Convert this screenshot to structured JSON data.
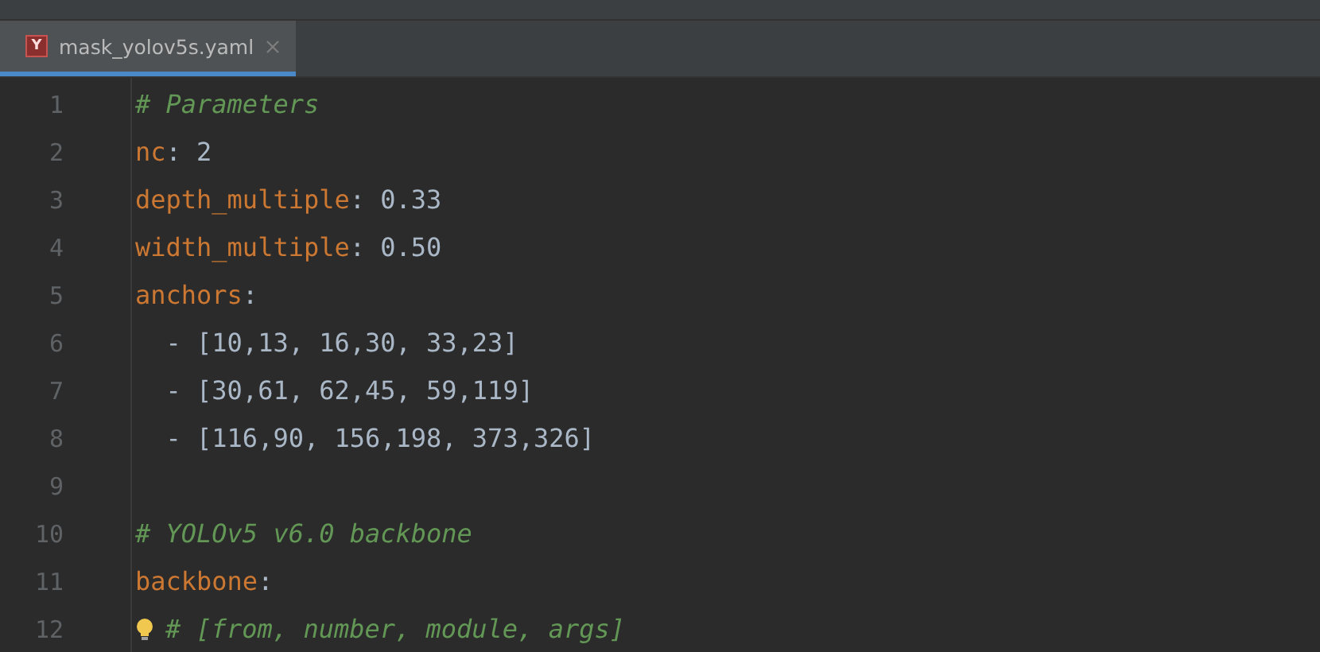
{
  "tabs": [
    {
      "label": "mask_yolov5s.yaml",
      "file_badge": "Y",
      "selected": true
    }
  ],
  "lines": [
    {
      "number": "1",
      "bulb": false,
      "tokens": [
        {
          "kind": "comment",
          "text": "# Parameters"
        }
      ]
    },
    {
      "number": "2",
      "bulb": false,
      "tokens": [
        {
          "kind": "key",
          "text": "nc"
        },
        {
          "kind": "value",
          "text": ": 2"
        }
      ]
    },
    {
      "number": "3",
      "bulb": false,
      "tokens": [
        {
          "kind": "key",
          "text": "depth_multiple"
        },
        {
          "kind": "value",
          "text": ": 0.33"
        }
      ]
    },
    {
      "number": "4",
      "bulb": false,
      "tokens": [
        {
          "kind": "key",
          "text": "width_multiple"
        },
        {
          "kind": "value",
          "text": ": 0.50"
        }
      ]
    },
    {
      "number": "5",
      "bulb": false,
      "tokens": [
        {
          "kind": "key",
          "text": "anchors"
        },
        {
          "kind": "value",
          "text": ":"
        }
      ]
    },
    {
      "number": "6",
      "bulb": false,
      "tokens": [
        {
          "kind": "value",
          "text": "  - [10,13, 16,30, 33,23]"
        }
      ]
    },
    {
      "number": "7",
      "bulb": false,
      "tokens": [
        {
          "kind": "value",
          "text": "  - [30,61, 62,45, 59,119]"
        }
      ]
    },
    {
      "number": "8",
      "bulb": false,
      "tokens": [
        {
          "kind": "value",
          "text": "  - [116,90, 156,198, 373,326]"
        }
      ]
    },
    {
      "number": "9",
      "bulb": false
    },
    {
      "number": "10",
      "bulb": false,
      "tokens": [
        {
          "kind": "comment",
          "text": "# YOLOv5 v6.0 backbone"
        }
      ]
    },
    {
      "number": "11",
      "bulb": false,
      "tokens": [
        {
          "kind": "key",
          "text": "backbone"
        },
        {
          "kind": "value",
          "text": ":"
        }
      ]
    },
    {
      "number": "12",
      "bulb": true,
      "tokens": [
        {
          "kind": "comment",
          "text": "# [from, number, module, args]"
        }
      ]
    }
  ]
}
